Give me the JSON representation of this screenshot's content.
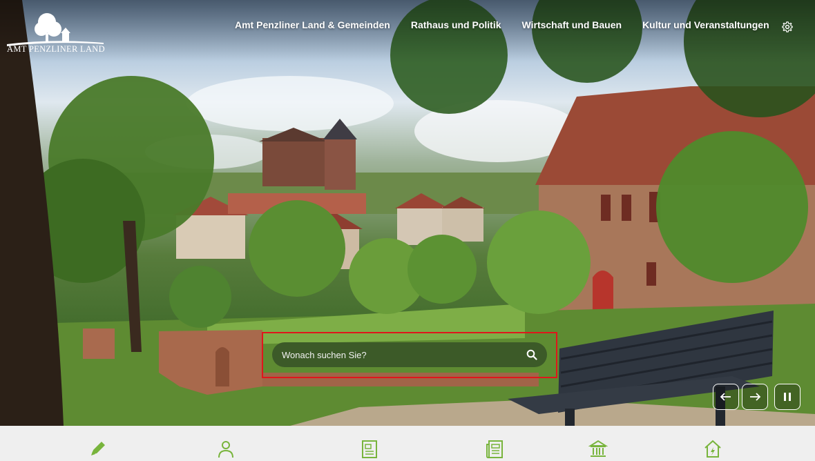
{
  "logo": {
    "name": "AMT PENZLINER LAND"
  },
  "nav": {
    "items": [
      {
        "label": "Amt Penzliner Land & Gemeinden"
      },
      {
        "label": "Rathaus und Politik"
      },
      {
        "label": "Wirtschaft und Bauen"
      },
      {
        "label": "Kultur und Veranstaltungen"
      }
    ]
  },
  "search": {
    "placeholder": "Wonach suchen Sie?"
  },
  "colors": {
    "accent": "#3c5a28",
    "icon_green": "#78b43c",
    "highlight": "#e0161b"
  },
  "icons": {
    "settings": "gear-icon",
    "search": "search-icon",
    "prev": "arrow-left-icon",
    "next": "arrow-right-icon",
    "pause": "pause-icon",
    "quick": [
      "pencil-icon",
      "person-icon",
      "document-image-icon",
      "newspaper-icon",
      "town-hall-icon",
      "house-icon"
    ]
  }
}
